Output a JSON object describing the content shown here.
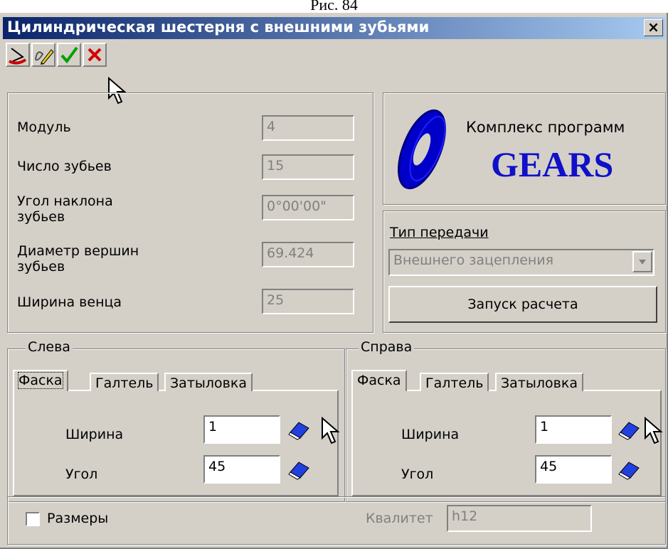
{
  "caption": "Рис. 84",
  "window": {
    "title": "Цилиндрическая шестерня с внешними зубьями",
    "close": "×"
  },
  "toolbar": {
    "icons": [
      "exit-icon",
      "edit-icon",
      "ok-checkmark-icon",
      "cancel-x-icon"
    ]
  },
  "params": [
    {
      "label": "Модуль",
      "value": "4"
    },
    {
      "label": "Число зубьев",
      "value": "15"
    },
    {
      "label": "Угол наклона\nзубьев",
      "value": "0°00'00\""
    },
    {
      "label": "Диаметр вершин\nзубьев",
      "value": "69.424"
    },
    {
      "label": "Ширина венца",
      "value": "25"
    }
  ],
  "logo": {
    "line1": "Комплекс программ",
    "line2": "GEARS"
  },
  "transmission": {
    "label": "Тип передачи",
    "value": "Внешнего зацепления",
    "run_button": "Запуск расчета"
  },
  "left": {
    "legend": "Слева",
    "tabs": [
      "Фаска",
      "Галтель",
      "Затыловка"
    ],
    "width_label": "Ширина",
    "width_value": "1",
    "angle_label": "Угол",
    "angle_value": "45"
  },
  "right": {
    "legend": "Справа",
    "tabs": [
      "Фаска",
      "Галтель",
      "Затыловка"
    ],
    "width_label": "Ширина",
    "width_value": "1",
    "angle_label": "Угол",
    "angle_value": "45"
  },
  "bottom": {
    "sizes_label": "Размеры",
    "sizes_checked": false,
    "quality_label": "Квалитет",
    "quality_value": "h12"
  }
}
